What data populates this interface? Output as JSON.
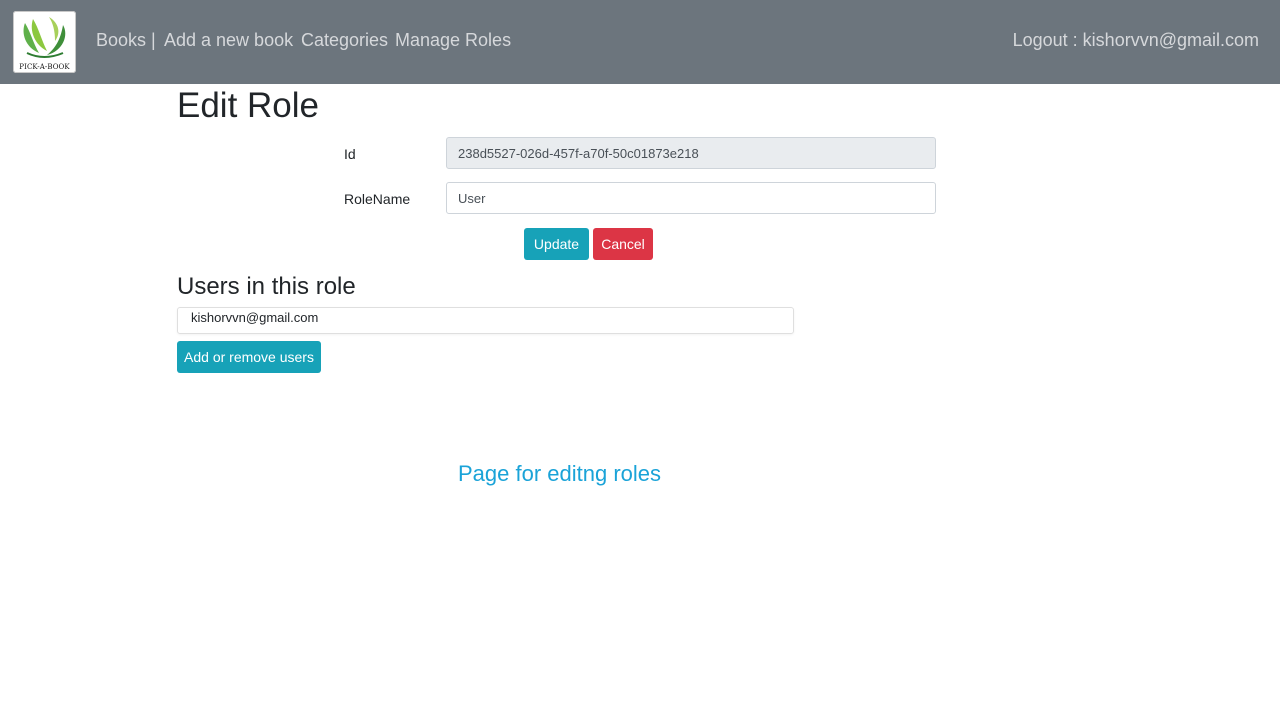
{
  "navbar": {
    "logo_text": "PICK-A-BOOK",
    "links": [
      "Books |",
      "Add a new book",
      "Categories",
      "Manage Roles"
    ],
    "logout": "Logout : kishorvvn@gmail.com"
  },
  "page": {
    "title": "Edit Role"
  },
  "form": {
    "id_label": "Id",
    "id_value": "238d5527-026d-457f-a70f-50c01873e218",
    "rolename_label": "RoleName",
    "rolename_value": "User",
    "update_label": "Update",
    "cancel_label": "Cancel"
  },
  "users": {
    "title": "Users in this role",
    "items": [
      "kishorvvn@gmail.com"
    ],
    "manage_label": "Add or remove users"
  },
  "footer": {
    "note": "Page for editng roles"
  },
  "colors": {
    "navbar_bg": "#6c757d",
    "info": "#17a2b8",
    "danger": "#dc3545",
    "note": "#1aa3d8"
  }
}
